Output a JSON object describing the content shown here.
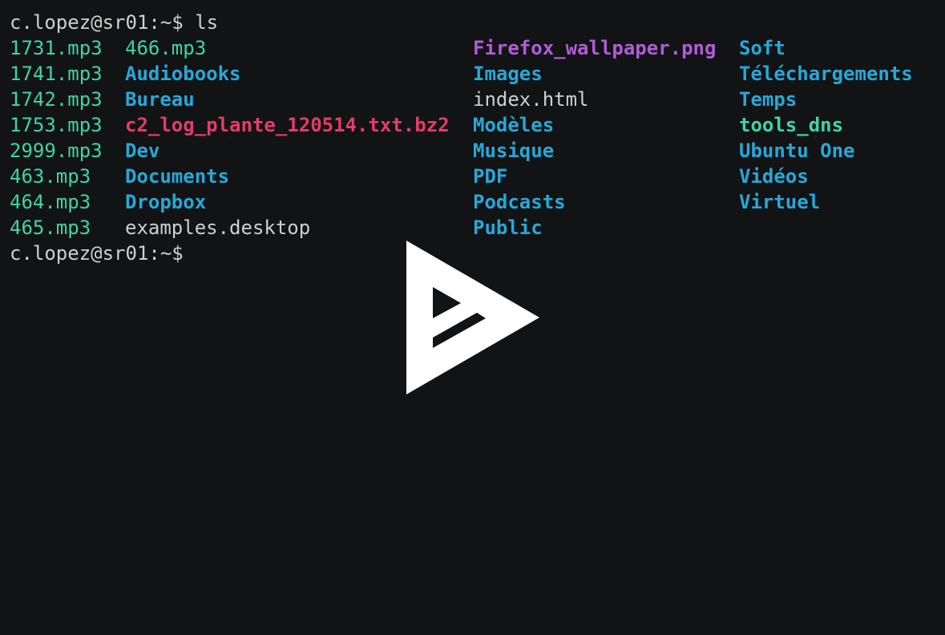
{
  "prompt_user": "c.lopez@sr01:~$",
  "command": "ls",
  "listing": {
    "col1": [
      {
        "name": "1731.mp3",
        "type": "audio"
      },
      {
        "name": "1741.mp3",
        "type": "audio"
      },
      {
        "name": "1742.mp3",
        "type": "audio"
      },
      {
        "name": "1753.mp3",
        "type": "audio"
      },
      {
        "name": "2999.mp3",
        "type": "audio"
      },
      {
        "name": "463.mp3",
        "type": "audio"
      },
      {
        "name": "464.mp3",
        "type": "audio"
      },
      {
        "name": "465.mp3",
        "type": "audio"
      }
    ],
    "col2": [
      {
        "name": "466.mp3",
        "type": "audio"
      },
      {
        "name": "Audiobooks",
        "type": "dir"
      },
      {
        "name": "Bureau",
        "type": "dir"
      },
      {
        "name": "c2_log_plante_120514.txt.bz2",
        "type": "archive"
      },
      {
        "name": "Dev",
        "type": "dir"
      },
      {
        "name": "Documents",
        "type": "dir"
      },
      {
        "name": "Dropbox",
        "type": "dir"
      },
      {
        "name": "examples.desktop",
        "type": "file"
      }
    ],
    "col3": [
      {
        "name": "Firefox_wallpaper.png",
        "type": "image"
      },
      {
        "name": "Images",
        "type": "dir"
      },
      {
        "name": "index.html",
        "type": "file"
      },
      {
        "name": "Modèles",
        "type": "dir"
      },
      {
        "name": "Musique",
        "type": "dir"
      },
      {
        "name": "PDF",
        "type": "dir"
      },
      {
        "name": "Podcasts",
        "type": "dir"
      },
      {
        "name": "Public",
        "type": "dir"
      }
    ],
    "col4": [
      {
        "name": "Soft",
        "type": "dir"
      },
      {
        "name": "Téléchargements",
        "type": "dir"
      },
      {
        "name": "Temps",
        "type": "dir"
      },
      {
        "name": "tools_dns",
        "type": "exec"
      },
      {
        "name": "Ubuntu One",
        "type": "dir"
      },
      {
        "name": "Vidéos",
        "type": "dir"
      },
      {
        "name": "Virtuel",
        "type": "dir"
      }
    ]
  },
  "colors": {
    "background": "#121314",
    "text": "#cfcfcf",
    "audio": "#3fd4a6",
    "directory": "#27a8d8",
    "archive": "#e23d6a",
    "image": "#b15cd8"
  },
  "overlay": {
    "icon": "asciinema-play-icon"
  }
}
